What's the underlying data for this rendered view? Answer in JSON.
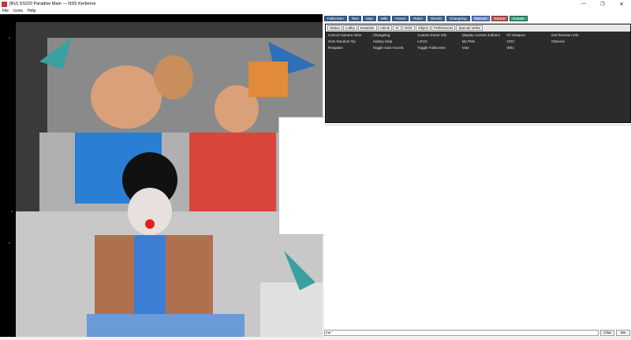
{
  "window": {
    "title": "[RU] SS220 Paradise Main — NSS Kerberos",
    "icon": "game-icon",
    "controls": [
      "minimize",
      "maximize",
      "close"
    ]
  },
  "menu": [
    "File",
    "Icons",
    "Help"
  ],
  "top_buttons": [
    {
      "label": "Fullscreen",
      "style": "normal"
    },
    {
      "label": "Text",
      "style": "normal"
    },
    {
      "label": "Map",
      "style": "normal"
    },
    {
      "label": "Wiki",
      "style": "normal"
    },
    {
      "label": "Forum",
      "style": "normal"
    },
    {
      "label": "Rules",
      "style": "normal"
    },
    {
      "label": "GitHub",
      "style": "normal"
    },
    {
      "label": "Changelog",
      "style": "normal"
    },
    {
      "label": "Discord",
      "style": "discord"
    },
    {
      "label": "Karma",
      "style": "karma"
    },
    {
      "label": "Donate",
      "style": "donate"
    }
  ],
  "tabs": [
    "Status",
    "Lobby",
    "Examine",
    "Admin",
    "IC",
    "OOC",
    "Object",
    "Preferences",
    "Special Verbs"
  ],
  "verbs": [
    "Cancel Camera View",
    "Changelog",
    "Custom Event Info",
    "Display Current Jobbers",
    "Fit Viewport",
    "Get Revision Info",
    "Give Random Tip",
    "Hotkey Help",
    "LOOC",
    "My PMs",
    "OOC",
    "Observe",
    "Respawn",
    "Toggle Auto-Accent",
    "Toggle Fullscreen",
    "Vote",
    "Who",
    ""
  ],
  "input": {
    "value": "me \"",
    "chat_label": "Chat",
    "me_label": "Me"
  }
}
